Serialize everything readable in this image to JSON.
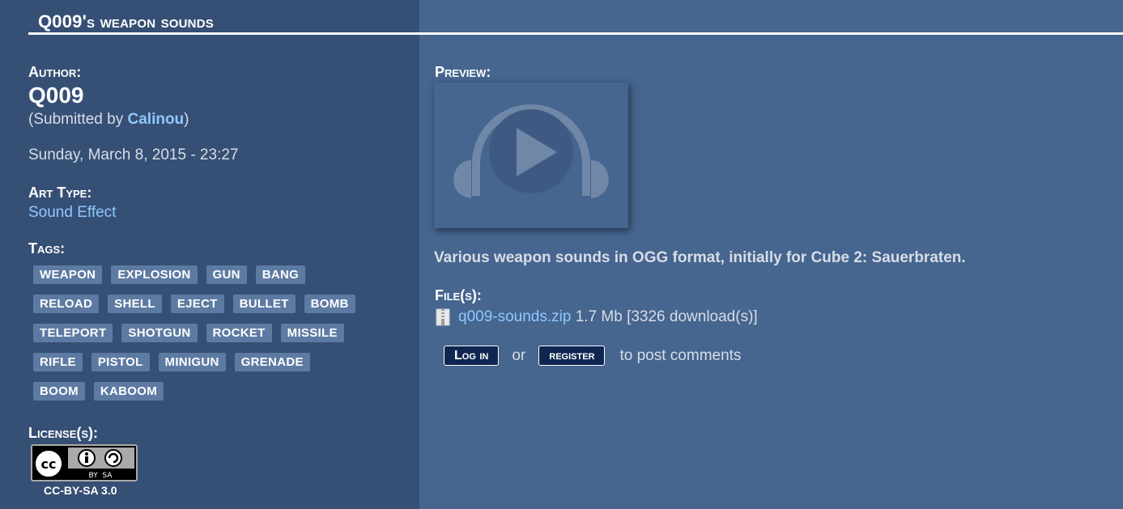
{
  "page": {
    "title": "Q009's weapon sounds"
  },
  "author": {
    "label": "Author:",
    "name": "Q009",
    "submitted_prefix": "(Submitted by ",
    "submitted_by": "Calinou",
    "submitted_suffix": ")"
  },
  "date": "Sunday, March 8, 2015 - 23:27",
  "art_type": {
    "label": "Art Type:",
    "value": "Sound Effect"
  },
  "tags": {
    "label": "Tags:",
    "rows": [
      [
        "WEAPON",
        "EXPLOSION",
        "GUN",
        "BANG"
      ],
      [
        "RELOAD",
        "SHELL",
        "EJECT",
        "BULLET",
        "BOMB"
      ],
      [
        "TELEPORT",
        "SHOTGUN",
        "ROCKET",
        "MISSILE"
      ],
      [
        "RIFLE",
        "PISTOL",
        "MINIGUN",
        "GRENADE"
      ],
      [
        "BOOM",
        "KABOOM"
      ]
    ]
  },
  "license": {
    "label": "License(s):",
    "badge_text": "BY  SA",
    "name": "CC-BY-SA 3.0"
  },
  "preview": {
    "label": "Preview:",
    "icon": "headphones-play-icon"
  },
  "description": "Various weapon sounds in OGG format, initially for Cube 2: Sauerbraten.",
  "files": {
    "label": "File(s):",
    "icon": "zip-file-icon",
    "name": "q009-sounds.zip",
    "info": " 1.7 Mb [3326 download(s)]"
  },
  "comments": {
    "login_label": "Log in",
    "or_text": "or",
    "register_label": "register",
    "suffix": "to post comments"
  },
  "colors": {
    "background": "#46658f",
    "sidebar": "#364f75",
    "link": "#8fc8ff",
    "tag_bg": "#5d7aa2",
    "button_bg": "#0f2750"
  }
}
